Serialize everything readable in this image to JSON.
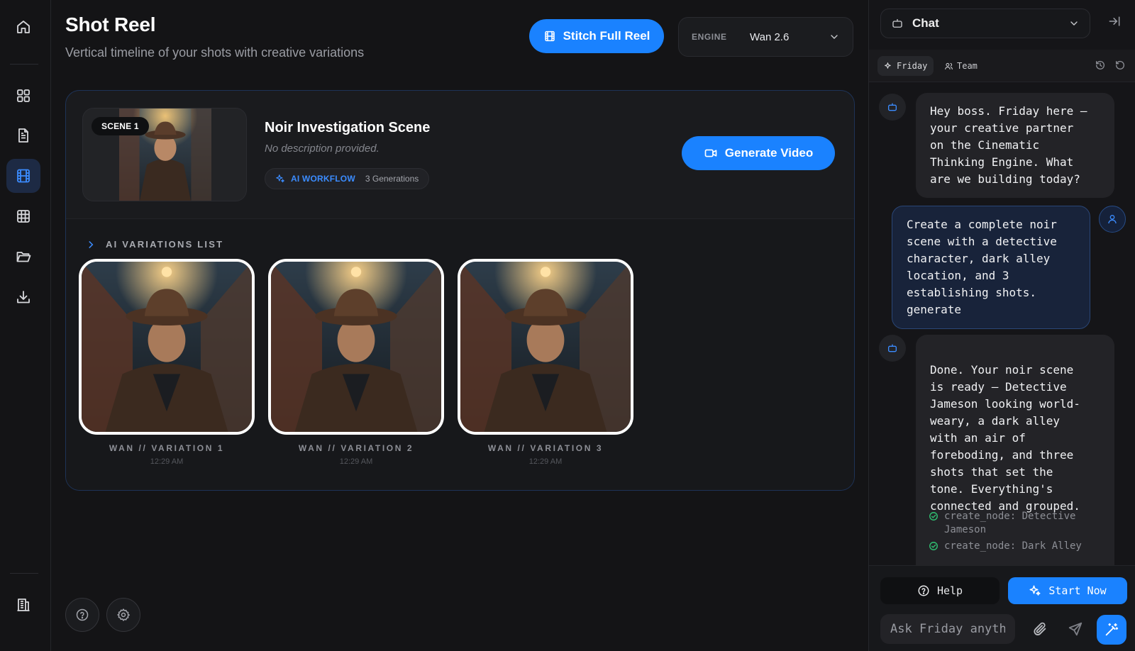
{
  "nav": {
    "items": [
      {
        "icon": "home-icon"
      },
      {
        "icon": "grid-icon"
      },
      {
        "icon": "document-icon"
      },
      {
        "icon": "film-icon",
        "active": true
      },
      {
        "icon": "table-icon"
      },
      {
        "icon": "folder-icon"
      },
      {
        "icon": "download-icon"
      }
    ],
    "bottom_icon": "building-icon"
  },
  "header": {
    "title": "Shot Reel",
    "subtitle": "Vertical timeline of your shots with creative variations",
    "stitch_label": "Stitch Full Reel",
    "engine_label": "ENGINE",
    "engine_value": "Wan 2.6"
  },
  "scene": {
    "badge": "SCENE 1",
    "name": "Noir Investigation Scene",
    "description": "No description provided.",
    "workflow_label": "AI WORKFLOW",
    "generations": "3 Generations",
    "generate_label": "Generate Video"
  },
  "variations": {
    "header": "AI VARIATIONS LIST",
    "items": [
      {
        "caption": "WAN // VARIATION 1",
        "time": "12:29 AM"
      },
      {
        "caption": "WAN // VARIATION 2",
        "time": "12:29 AM"
      },
      {
        "caption": "WAN // VARIATION 3",
        "time": "12:29 AM"
      }
    ]
  },
  "chat": {
    "selector": "Chat",
    "tabs": [
      "Friday",
      "Team"
    ],
    "messages": [
      {
        "role": "ai",
        "text": "Hey boss. Friday here –\nyour creative partner\non the Cinematic\nThinking Engine. What\nare we building today?"
      },
      {
        "role": "user",
        "text": "Create a complete noir\nscene with a detective\ncharacter, dark alley\nlocation, and 3\nestablishing shots.\ngenerate"
      },
      {
        "role": "ai",
        "text": "Done. Your noir scene\nis ready – Detective\nJameson looking world-\nweary, a dark alley\nwith an air of\nforeboding, and three\nshots that set the\ntone. Everything's\nconnected and grouped."
      }
    ],
    "tools": [
      "create_node: Detective\nJameson",
      "create_node: Dark Alley"
    ],
    "help_label": "Help",
    "start_label": "Start Now",
    "input_placeholder": "Ask Friday anything..."
  },
  "colors": {
    "accent": "#1a82ff",
    "success": "#2fbf71",
    "background": "#141416"
  }
}
